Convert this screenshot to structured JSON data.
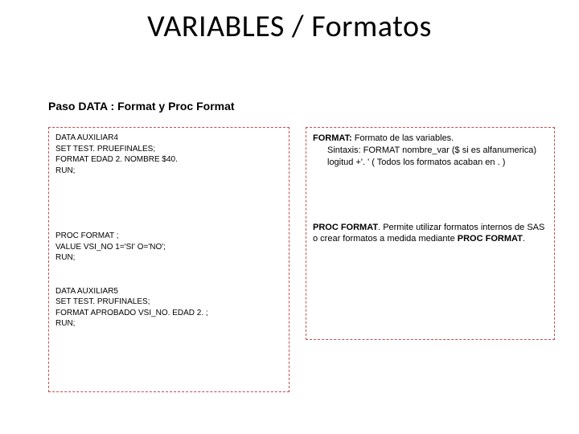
{
  "title": "VARIABLES  / Formatos",
  "subtitle": "Paso DATA : Format y Proc Format",
  "left": {
    "block1": "DATA AUXILIAR4\nSET TEST. PRUEFINALES;\nFORMAT EDAD  2. NOMBRE $40.\nRUN;",
    "block2": "PROC FORMAT ;\nVALUE VSI_NO 1='SI' O='NO';\nRUN;",
    "block3": "DATA AUXILIAR5\nSET TEST. PRUFINALES;\nFORMAT APROBADO VSI_NO. EDAD 2. ;\nRUN;"
  },
  "right": {
    "format_label": "FORMAT:",
    "format_text": " Formato de las variables.",
    "format_syntax": "Sintaxis: FORMAT nombre_var ($ si es alfanumerica) logitud +'. ' ( Todos los formatos acaban en . )",
    "proc_label": "PROC FORMAT",
    "proc_text_a": ". Permite utilizar formatos internos de SAS o crear formatos a medida mediante ",
    "proc_bold": "PROC FORMAT",
    "proc_text_b": "."
  }
}
